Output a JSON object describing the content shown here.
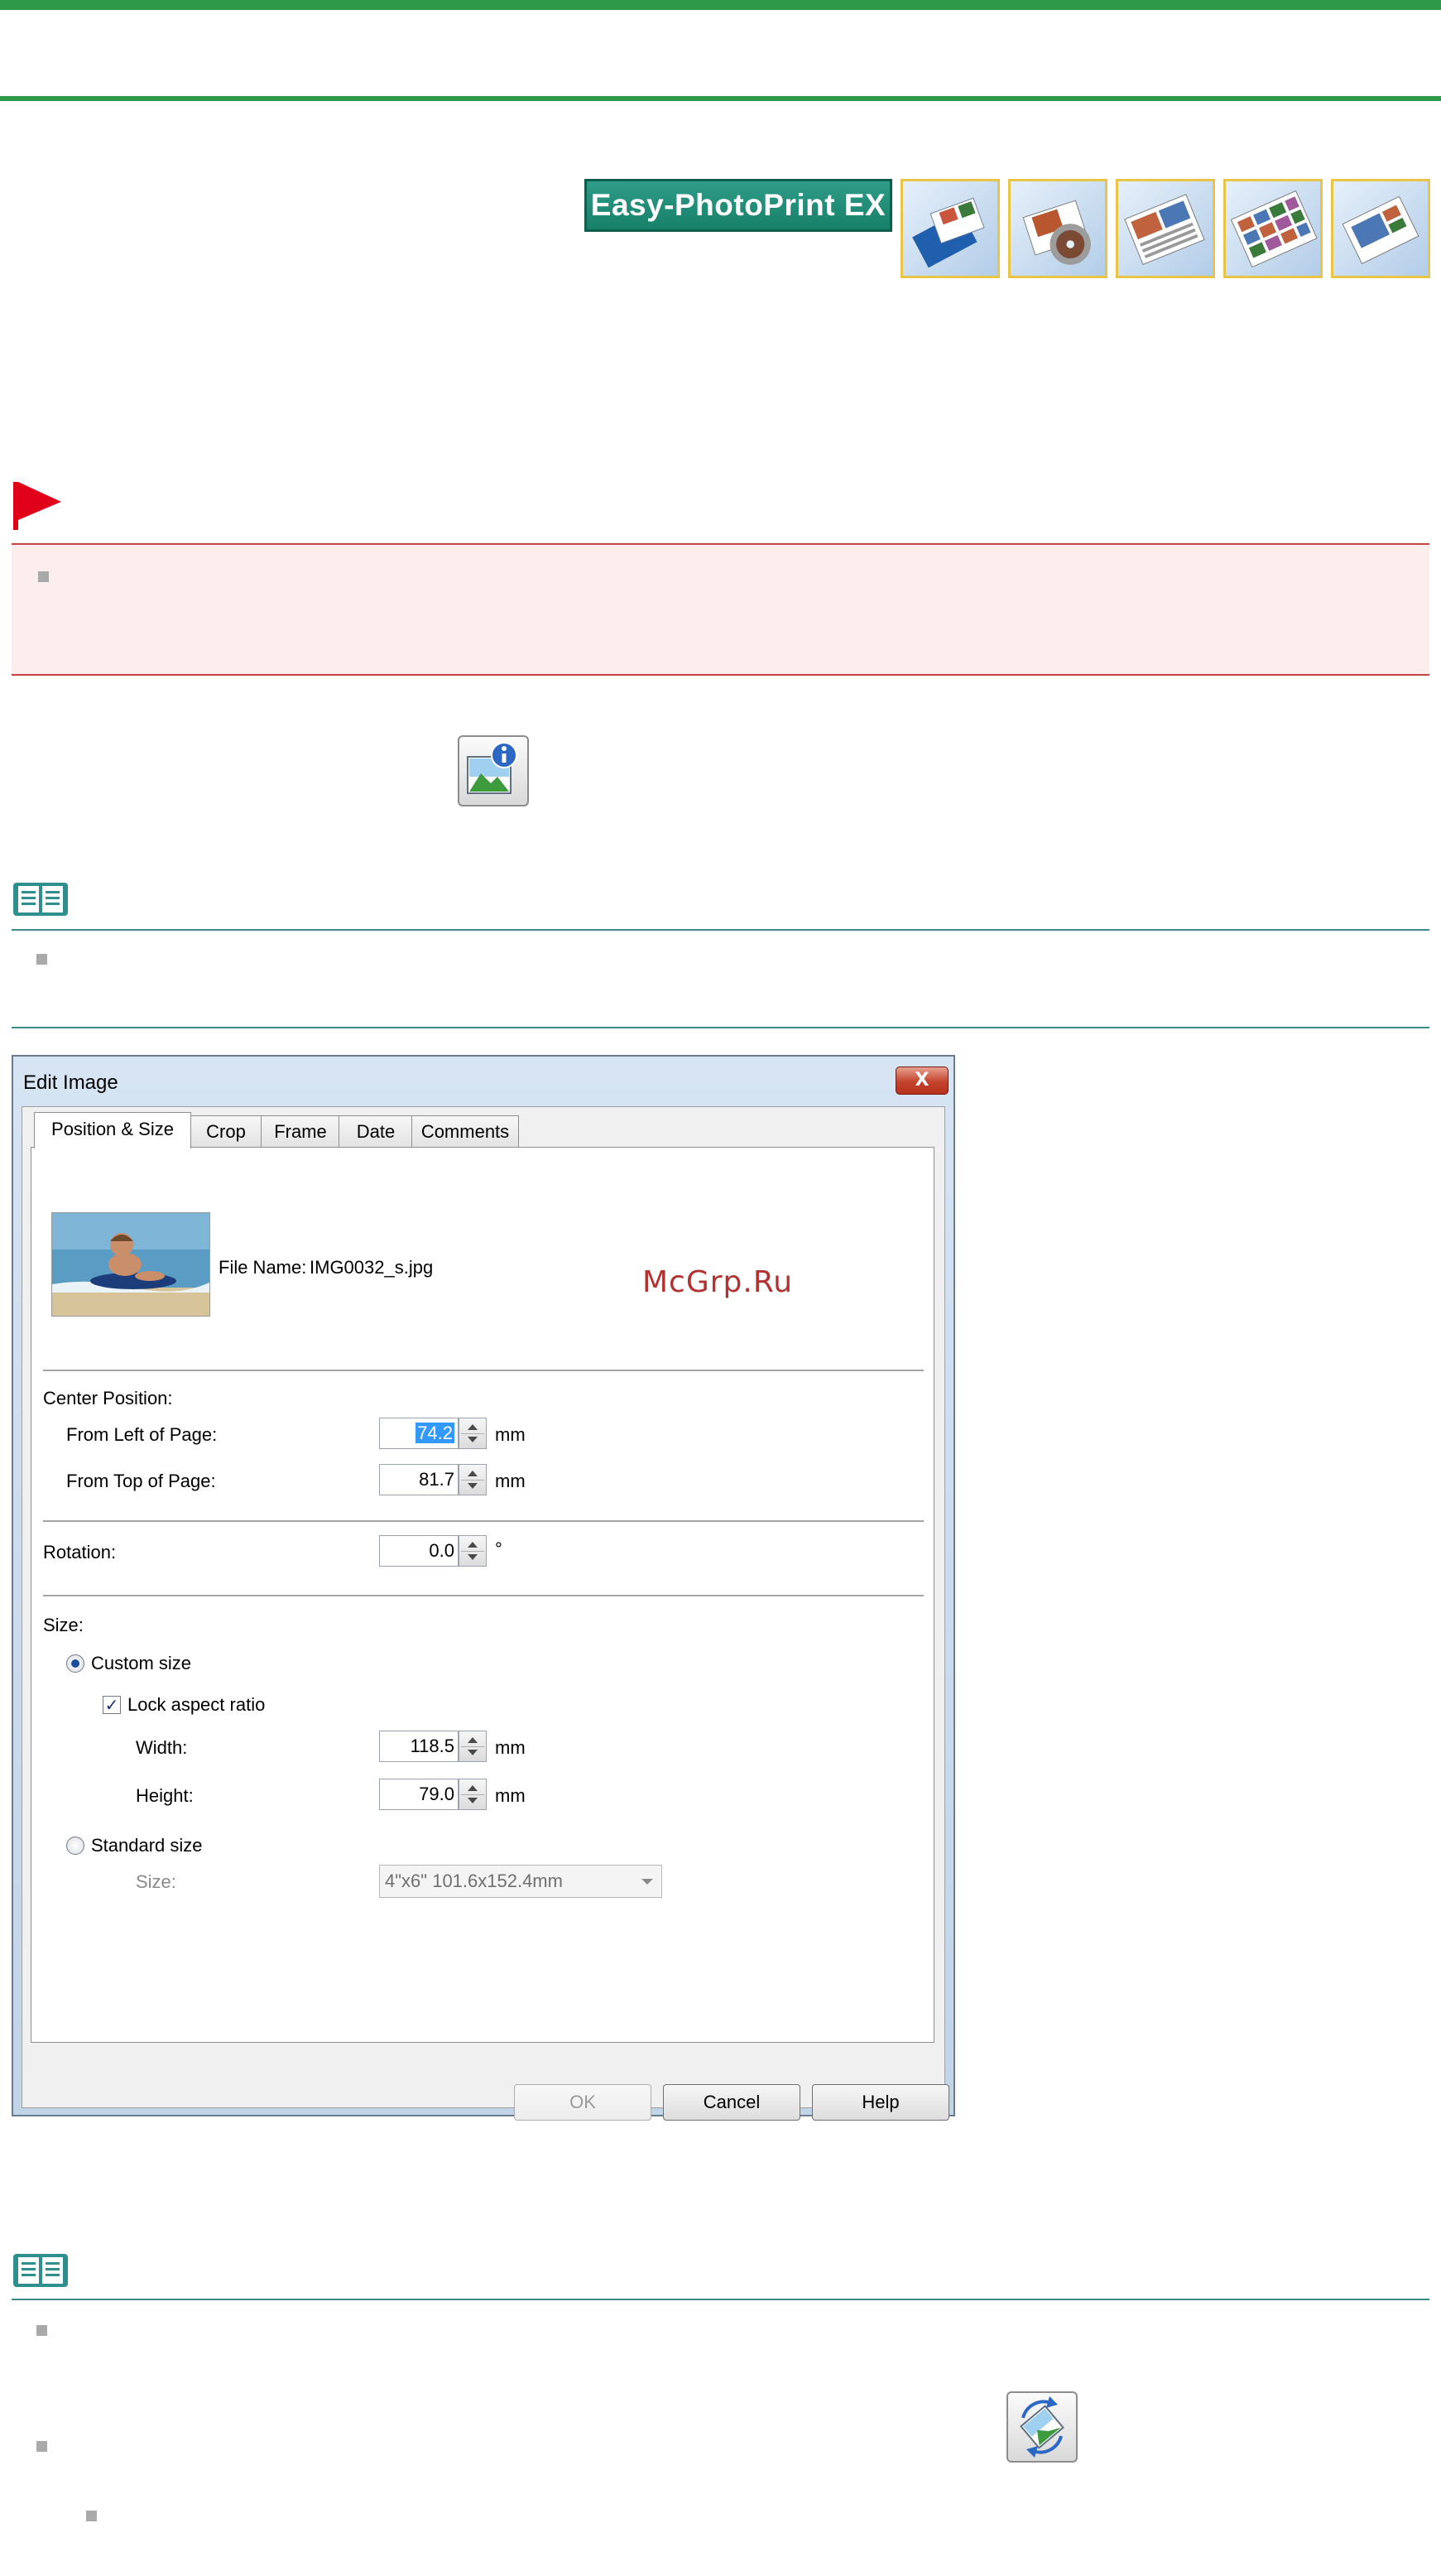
{
  "banner": {
    "logo_text": "Easy-PhotoPrint EX",
    "thumbnails": [
      "album-thumbnail",
      "disc-label-thumbnail",
      "calendar-thumbnail",
      "stickers-thumbnail",
      "layout-print-thumbnail"
    ]
  },
  "dialog": {
    "title": "Edit Image",
    "close_label": "X",
    "tabs": [
      "Position & Size",
      "Crop",
      "Frame",
      "Date",
      "Comments"
    ],
    "active_tab": "Position & Size",
    "file_name_label": "File Name:",
    "file_name": "IMG0032_s.jpg",
    "center_position": {
      "heading": "Center Position:",
      "from_left_label": "From Left of Page:",
      "from_left_value": "74.2",
      "from_top_label": "From Top of Page:",
      "from_top_value": "81.7",
      "unit": "mm"
    },
    "rotation": {
      "label": "Rotation:",
      "value": "0.0",
      "unit": "°"
    },
    "size": {
      "heading": "Size:",
      "custom_label": "Custom size",
      "custom_selected": true,
      "lock_label": "Lock aspect ratio",
      "lock_checked": true,
      "check_mark": "✓",
      "width_label": "Width:",
      "width_value": "118.5",
      "height_label": "Height:",
      "height_value": "79.0",
      "unit": "mm",
      "standard_label": "Standard size",
      "standard_size_label": "Size:",
      "standard_size_value": "4\"x6\" 101.6x152.4mm"
    },
    "buttons": {
      "ok": "OK",
      "cancel": "Cancel",
      "help": "Help"
    }
  },
  "watermark": "McGrp.Ru",
  "colors": {
    "header_rule": "#2e9a47",
    "important_border": "#c44444",
    "important_bg": "#fdeeee",
    "note_rule": "#3c8b8b",
    "flag": "#e0001a"
  }
}
